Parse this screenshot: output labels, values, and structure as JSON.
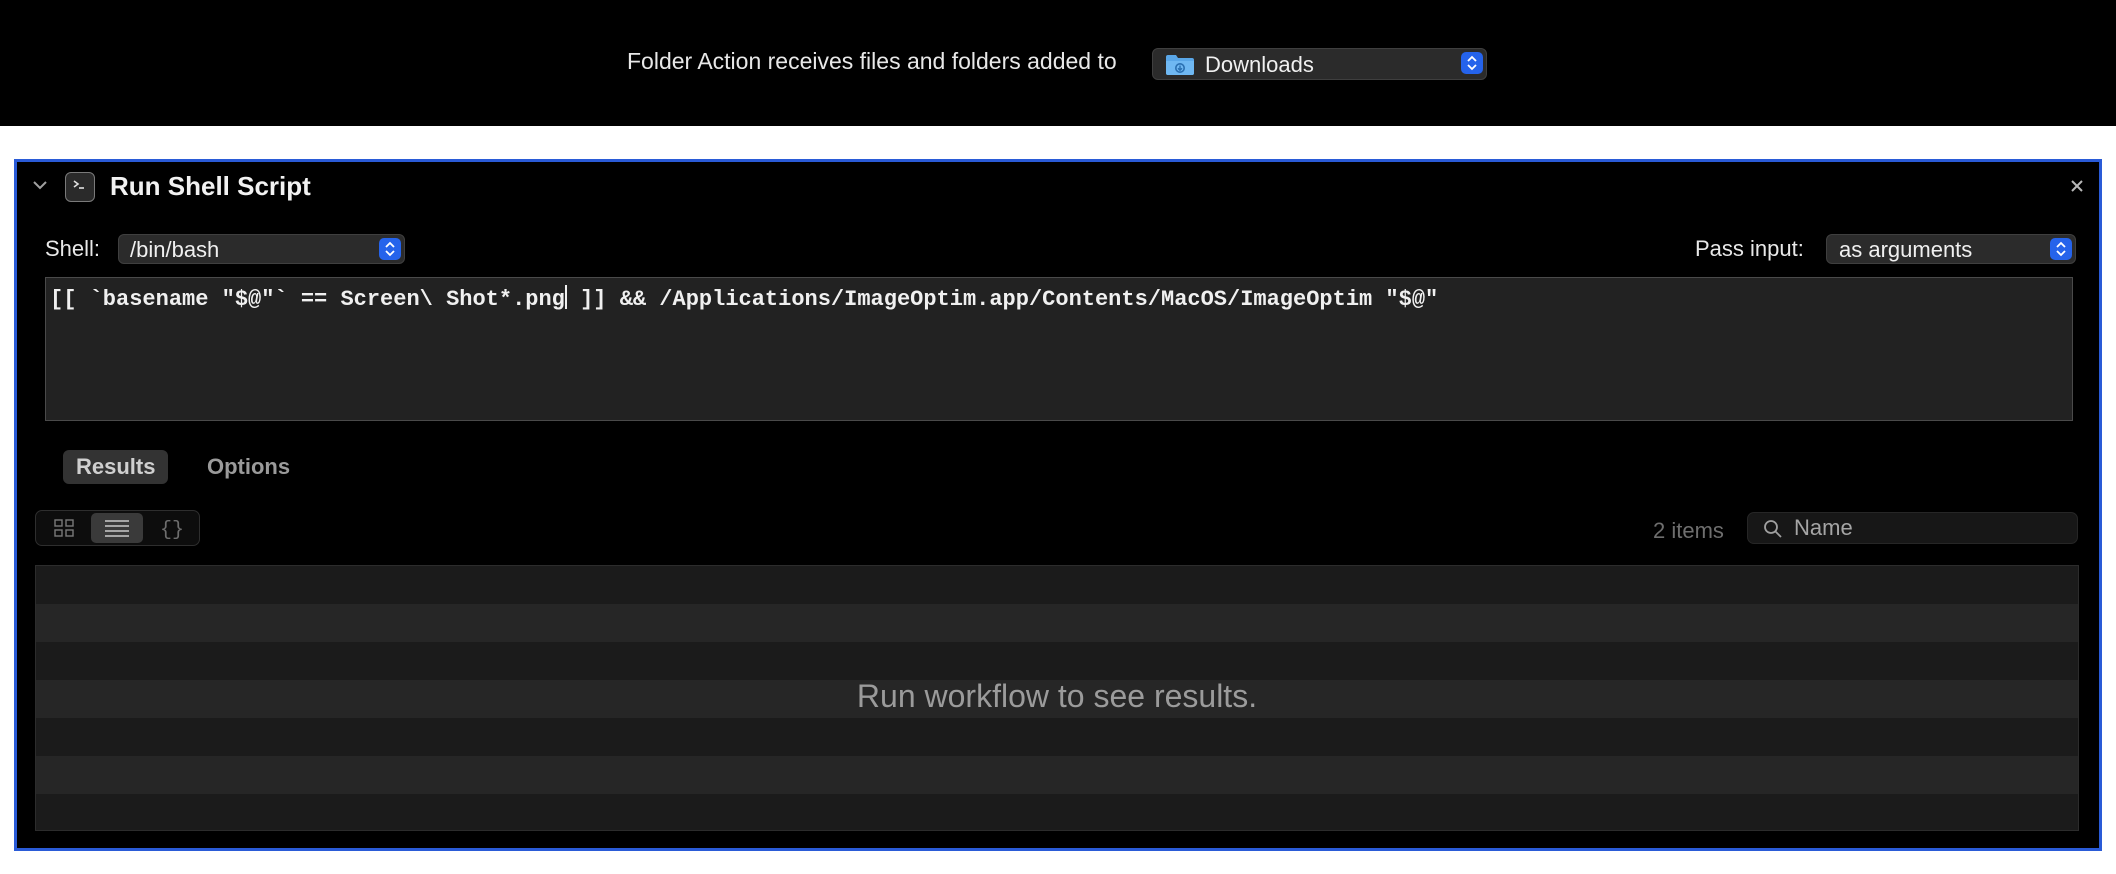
{
  "header": {
    "receives_label": "Folder Action receives files and folders added to",
    "folder_popup": {
      "value": "Downloads",
      "icon": "downloads-folder-icon"
    }
  },
  "action": {
    "title": "Run Shell Script",
    "icon": "terminal-icon",
    "shell": {
      "label": "Shell:",
      "value": "/bin/bash"
    },
    "pass_input": {
      "label": "Pass input:",
      "value": "as arguments"
    },
    "script": {
      "before_caret": "[[ `basename \"$@\"` == Screen\\ Shot*.png",
      "after_caret": " ]] && /Applications/ImageOptim.app/Contents/MacOS/ImageOptim \"$@\""
    },
    "tabs": [
      {
        "label": "Results",
        "selected": true
      },
      {
        "label": "Options",
        "selected": false
      }
    ],
    "view_modes": [
      "icon-view",
      "list-view",
      "code-view"
    ],
    "selected_view": "list-view",
    "code_view_glyph": "{}",
    "items_count": "2 items",
    "search": {
      "placeholder": "Name",
      "value": ""
    },
    "empty_message": "Run workflow to see results."
  },
  "colors": {
    "accent": "#2a5bd7",
    "stepper": "#2563eb",
    "panel_bg": "#000000",
    "editor_bg": "#222222"
  }
}
